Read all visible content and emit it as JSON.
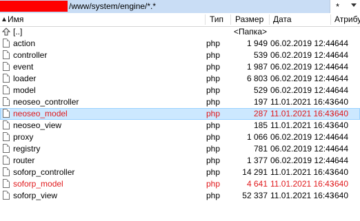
{
  "path_bar": {
    "path": "/www/system/engine/*.*",
    "filter_value": "*"
  },
  "columns": {
    "name": "Имя",
    "type": "Тип",
    "size": "Размер",
    "date": "Дата",
    "attributes": "Атрибу"
  },
  "parent_row": {
    "name": "[..]",
    "size": "<Папка>"
  },
  "files": [
    {
      "name": "action",
      "type": "php",
      "size": "1 949",
      "date": "06.02.2019 12:44",
      "attr": "-644",
      "highlight": "none"
    },
    {
      "name": "controller",
      "type": "php",
      "size": "539",
      "date": "06.02.2019 12:44",
      "attr": "-644",
      "highlight": "none"
    },
    {
      "name": "event",
      "type": "php",
      "size": "1 987",
      "date": "06.02.2019 12:44",
      "attr": "-644",
      "highlight": "none"
    },
    {
      "name": "loader",
      "type": "php",
      "size": "6 803",
      "date": "06.02.2019 12:44",
      "attr": "-644",
      "highlight": "none"
    },
    {
      "name": "model",
      "type": "php",
      "size": "529",
      "date": "06.02.2019 12:44",
      "attr": "-644",
      "highlight": "none"
    },
    {
      "name": "neoseo_controller",
      "type": "php",
      "size": "197",
      "date": "11.01.2021 16:43",
      "attr": "-640",
      "highlight": "none"
    },
    {
      "name": "neoseo_model",
      "type": "php",
      "size": "287",
      "date": "11.01.2021 16:43",
      "attr": "-640",
      "highlight": "selected-red"
    },
    {
      "name": "neoseo_view",
      "type": "php",
      "size": "185",
      "date": "11.01.2021 16:43",
      "attr": "-640",
      "highlight": "none"
    },
    {
      "name": "proxy",
      "type": "php",
      "size": "1 066",
      "date": "06.02.2019 12:44",
      "attr": "-644",
      "highlight": "none"
    },
    {
      "name": "registry",
      "type": "php",
      "size": "781",
      "date": "06.02.2019 12:44",
      "attr": "-644",
      "highlight": "none"
    },
    {
      "name": "router",
      "type": "php",
      "size": "1 377",
      "date": "06.02.2019 12:44",
      "attr": "-644",
      "highlight": "none"
    },
    {
      "name": "soforp_controller",
      "type": "php",
      "size": "14 291",
      "date": "11.01.2021 16:43",
      "attr": "-640",
      "highlight": "none"
    },
    {
      "name": "soforp_model",
      "type": "php",
      "size": "4 641",
      "date": "11.01.2021 16:43",
      "attr": "-640",
      "highlight": "red"
    },
    {
      "name": "soforp_view",
      "type": "php",
      "size": "52 337",
      "date": "11.01.2021 16:43",
      "attr": "-640",
      "highlight": "none"
    }
  ],
  "colors": {
    "path_bar_bg": "#c9ddf5",
    "redaction": "#ff0000",
    "selection_bg": "#cce8ff",
    "marked_text": "#e0191c"
  },
  "icons": {
    "parent": "up-folder-icon",
    "file": "file-icon",
    "sort": "sort-ascending-icon",
    "filter": "dropdown-arrow-icon"
  }
}
